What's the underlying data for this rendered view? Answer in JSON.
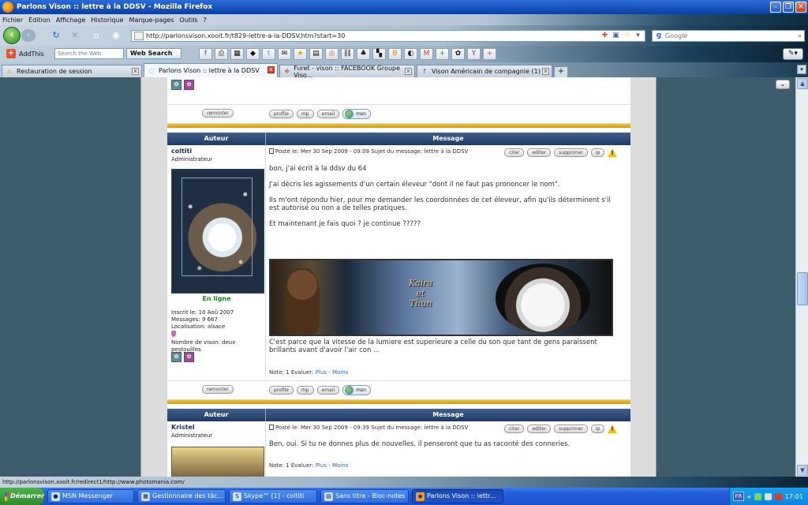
{
  "window": {
    "title": "Parlons Vison :: lettre à la DDSV - Mozilla Firefox"
  },
  "menu": [
    "Fichier",
    "Édition",
    "Affichage",
    "Historique",
    "Marque-pages",
    "Outils",
    "?"
  ],
  "nav": {
    "url": "http://parlonsvison.xooit.fr/t829-lettre-a-la-DDSV.htm?start=30",
    "search_placeholder": "Google"
  },
  "addthis": {
    "label": "AddThis",
    "search_placeholder": "Search the Web",
    "search_button": "Web Search"
  },
  "tabs": [
    {
      "label": "Restauration de session",
      "active": false
    },
    {
      "label": "Parlons Vison :: lettre à la DDSV",
      "active": true
    },
    {
      "label": "Furet - vison :: FACEBOOK Groupe Viso...",
      "active": false
    },
    {
      "label": "Vison Américain de compagnie (1)",
      "active": false
    }
  ],
  "buttons": {
    "remonter": "remonter",
    "profile": "profile",
    "mp": "mp",
    "email": "email",
    "msn": "msn",
    "citer": "citer",
    "editer": "editer",
    "supprimer": "supprimer",
    "ip": "ip"
  },
  "headers": {
    "author": "Auteur",
    "message": "Message"
  },
  "posts": [
    {
      "author": "coltiti",
      "role": "Administrateur",
      "status": "En ligne",
      "inscrit": "Inscrit le: 10 Aoû 2007",
      "messages": "Messages: 9 667",
      "localisation": "Localisation: alsace",
      "nombre_vison": "Nombre de vison: deux pestouilles",
      "meta": "Posté le: Mer 30 Sep 2009 - 09:09    Sujet du message: lettre à la DDSV",
      "body1": "bon, j'ai écrit à la ddsv du 64\n\nJ'ai décris les agissements d'un certain éleveur \"dont il ne faut pas prononcer le nom\".\n\nIls m'ont répondu hier, pour me demander les coordonnées de cet éleveur, afin qu'ils déterminent s'il est autorisé ou non a de telles pratiques.\n\nEt maintenant je fais quoi ? je continue ?????",
      "banner_text": "Kaira\net\nThun",
      "signature": "C'est parce que la vitesse de la lumiere est superieure a celle du son que tant de gens paraissent brillants avant d'avoir l'air con ...",
      "note_label": "Note: 1   Évaluer:",
      "note_plus": "Plus",
      "note_sep": " - ",
      "note_moins": "Moins"
    },
    {
      "author": "Kristel",
      "role": "Administrateur",
      "meta": "Posté le: Mer 30 Sep 2009 - 09:39    Sujet du message: lettre à la DDSV",
      "body1": "Ben, oui. Si tu ne donnes plus de nouvelles, il penseront que tu as raconté des conneries.",
      "note_label": "Note: 1   Évaluer:",
      "note_plus": "Plus",
      "note_sep": " - ",
      "note_moins": "Moins"
    }
  ],
  "status_bar": "http://parlonsvison.xooit.fr/redirect1/http://www.photomania.com/",
  "taskbar": {
    "start": "Démarrer",
    "tasks": [
      {
        "label": "MSN Messenger",
        "active": false
      },
      {
        "label": "Gestionnaire des tâc...",
        "active": false
      },
      {
        "label": "Skype™ [1] - coltiti",
        "active": false
      },
      {
        "label": "Sans titre - Bloc-notes",
        "active": false
      },
      {
        "label": "Parlons Vison :: lettr...",
        "active": true
      }
    ],
    "lang": "FR",
    "clock": "17:01"
  }
}
